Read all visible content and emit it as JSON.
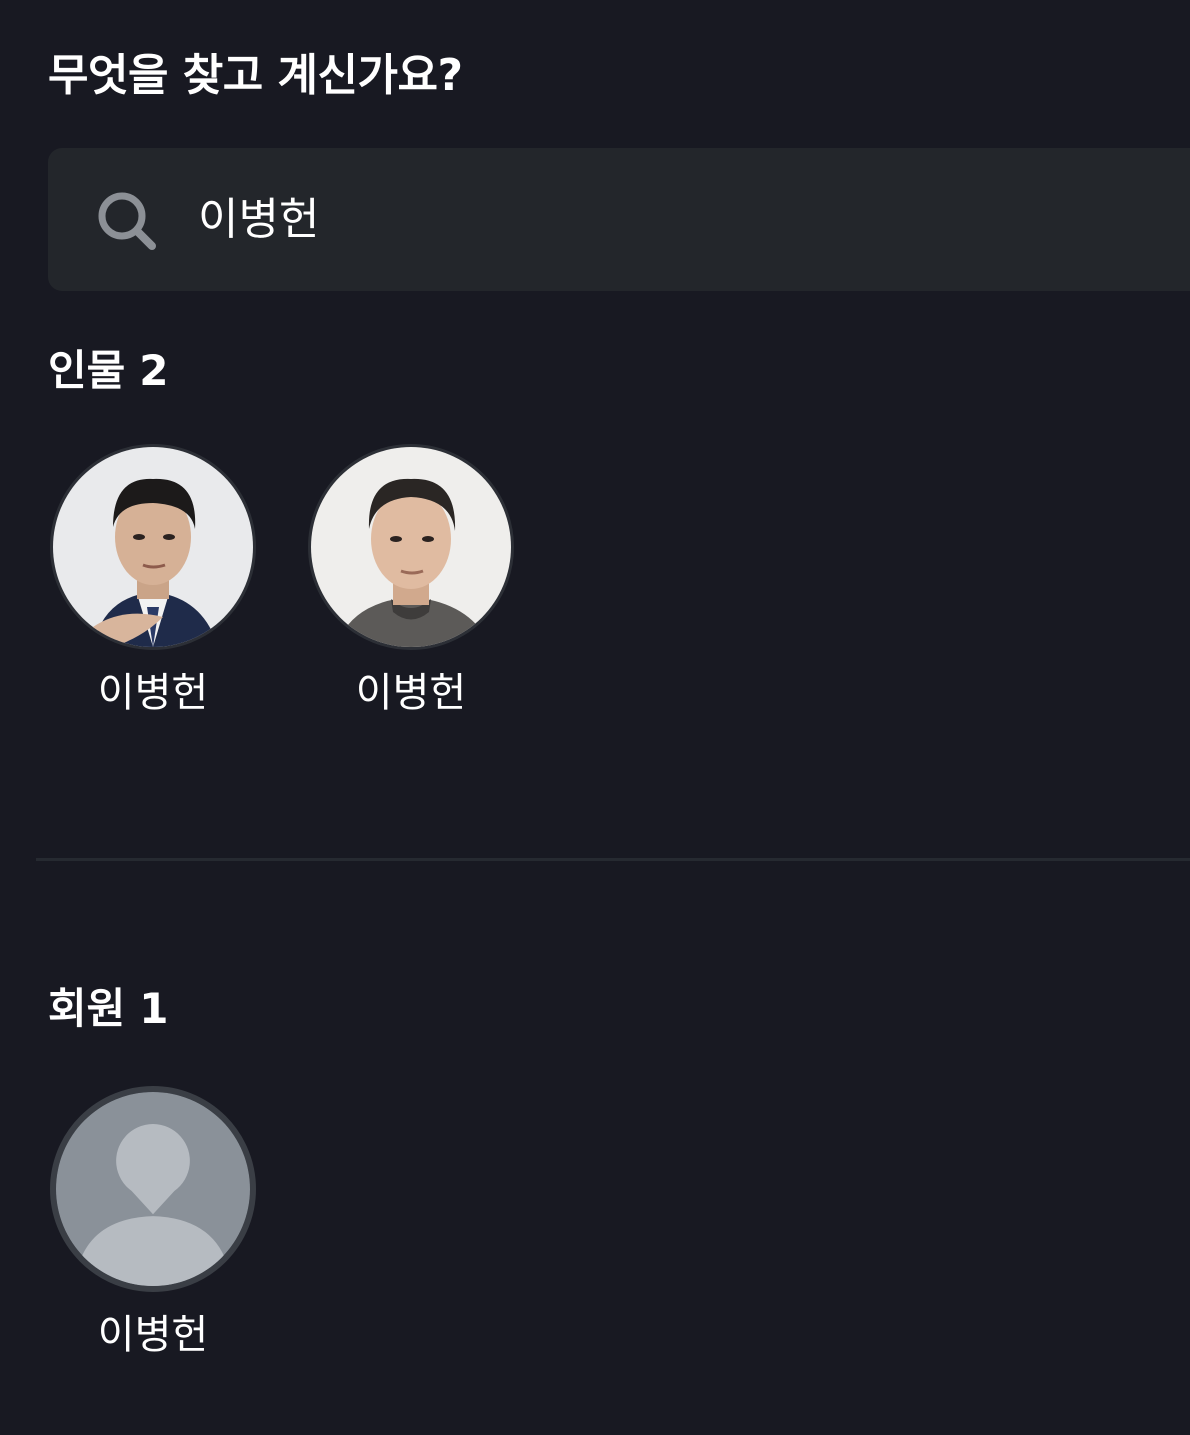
{
  "page": {
    "title": "무엇을 찾고 계신가요?"
  },
  "search": {
    "value": "이병헌"
  },
  "people_section": {
    "label": "인물",
    "count": "2",
    "items": [
      {
        "name": "이병헌"
      },
      {
        "name": "이병헌"
      }
    ]
  },
  "members_section": {
    "label": "회원",
    "count": "1",
    "items": [
      {
        "name": "이병헌"
      }
    ]
  },
  "colors": {
    "background": "#181922",
    "search_bg": "#23262b",
    "text": "#ffffff",
    "icon": "#8c9096"
  }
}
